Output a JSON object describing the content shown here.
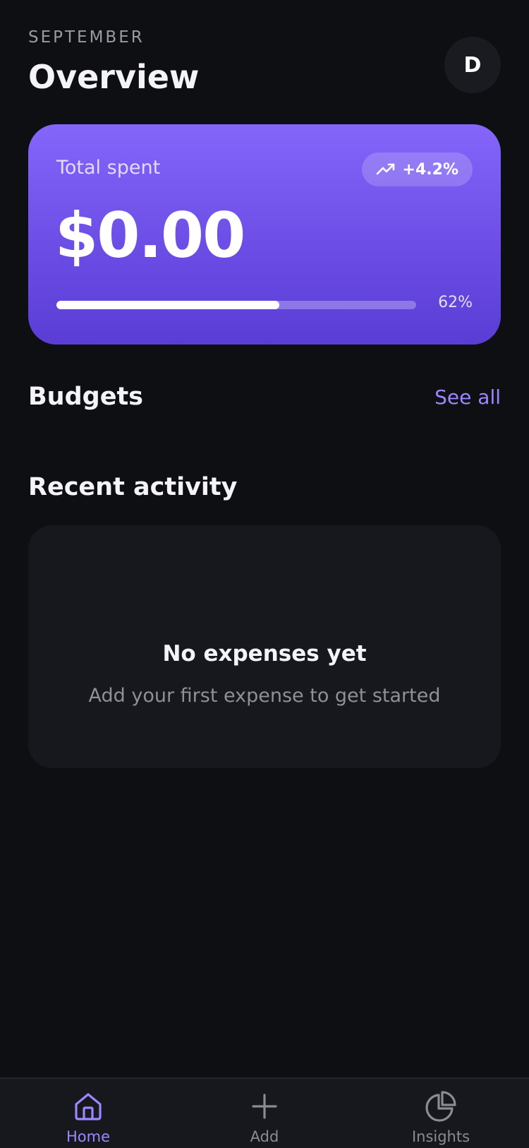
{
  "header": {
    "month": "SEPTEMBER",
    "title": "Overview",
    "avatar_initial": "D"
  },
  "summary_card": {
    "label": "Total spent",
    "amount": "$0.00",
    "trend": "+4.2%",
    "trend_icon": "trending-up-icon",
    "progress_text": "62%",
    "progress_fraction": 0.62
  },
  "budgets": {
    "title": "Budgets",
    "see_all": "See all"
  },
  "recent": {
    "title": "Recent activity",
    "empty_title": "No expenses yet",
    "empty_subtitle": "Add your first expense to get started"
  },
  "tabbar": {
    "items": [
      {
        "label": "Home",
        "icon": "home-icon",
        "active": true
      },
      {
        "label": "Add",
        "icon": "plus-icon",
        "active": false
      },
      {
        "label": "Insights",
        "icon": "pie-chart-icon",
        "active": false
      }
    ]
  },
  "colors": {
    "background": "#0e0f13",
    "card_gradient_top": "#8566fb",
    "card_gradient_bottom": "#5a3dd4",
    "accent": "#9d86ff",
    "surface": "#17181d",
    "inactive_icon": "#8b8b93"
  }
}
